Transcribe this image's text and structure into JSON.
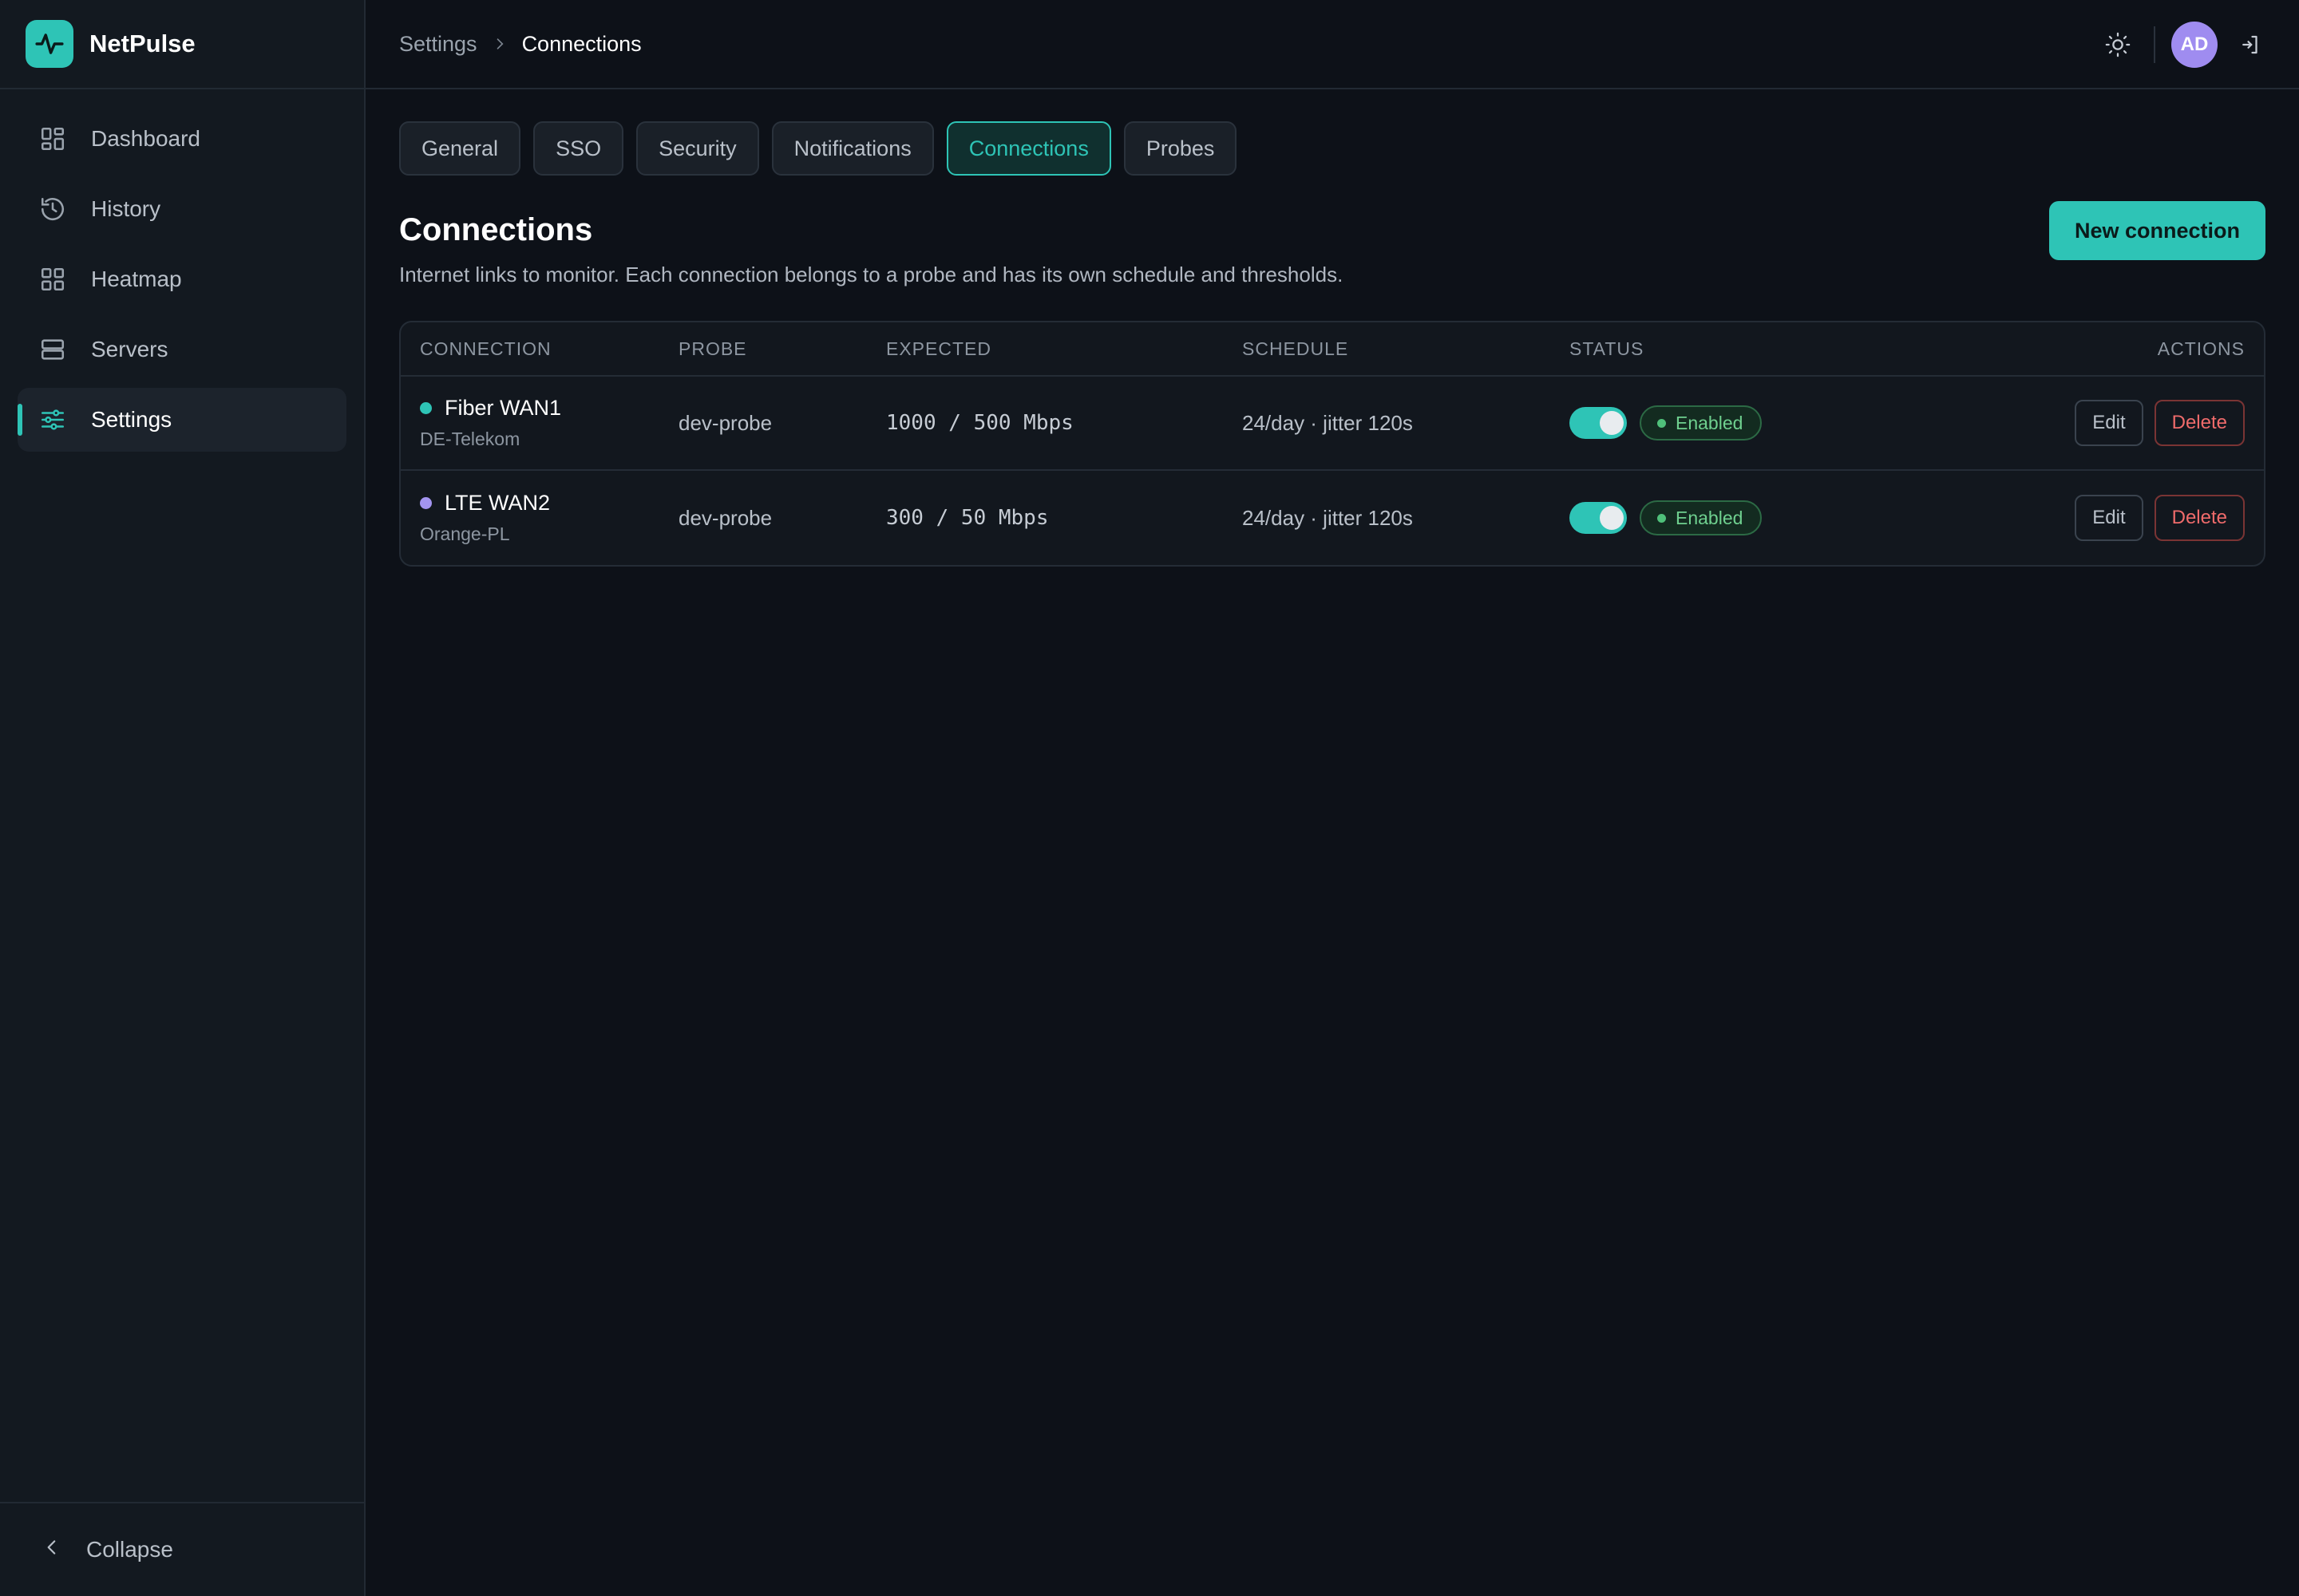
{
  "app": {
    "name": "NetPulse",
    "accent": "#2ec4b6"
  },
  "sidebar": {
    "items": [
      {
        "label": "Dashboard",
        "icon": "dashboard-icon"
      },
      {
        "label": "History",
        "icon": "history-icon"
      },
      {
        "label": "Heatmap",
        "icon": "heatmap-icon"
      },
      {
        "label": "Servers",
        "icon": "servers-icon"
      },
      {
        "label": "Settings",
        "icon": "settings-sliders-icon",
        "active": true
      }
    ],
    "collapse_label": "Collapse"
  },
  "breadcrumb": {
    "parent": "Settings",
    "current": "Connections"
  },
  "user": {
    "initials": "AD",
    "avatar_color": "#9f8cf0"
  },
  "tabs": [
    {
      "label": "General"
    },
    {
      "label": "SSO"
    },
    {
      "label": "Security"
    },
    {
      "label": "Notifications"
    },
    {
      "label": "Connections",
      "active": true
    },
    {
      "label": "Probes"
    }
  ],
  "page": {
    "title": "Connections",
    "subtitle": "Internet links to monitor. Each connection belongs to a probe and has its own schedule and thresholds.",
    "new_button": "New connection"
  },
  "table": {
    "headers": [
      "CONNECTION",
      "PROBE",
      "EXPECTED",
      "SCHEDULE",
      "STATUS",
      "ACTIONS"
    ],
    "rows": [
      {
        "name": "Fiber WAN1",
        "isp": "DE-Telekom",
        "dot_color": "#2ec4b6",
        "probe": "dev-probe",
        "expected": "1000 / 500 Mbps",
        "schedule": "24/day · jitter 120s",
        "enabled": true,
        "status": "Enabled",
        "edit": "Edit",
        "delete": "Delete"
      },
      {
        "name": "LTE WAN2",
        "isp": "Orange-PL",
        "dot_color": "#a394f0",
        "probe": "dev-probe",
        "expected": "300 / 50 Mbps",
        "schedule": "24/day · jitter 120s",
        "enabled": true,
        "status": "Enabled",
        "edit": "Edit",
        "delete": "Delete"
      }
    ]
  }
}
